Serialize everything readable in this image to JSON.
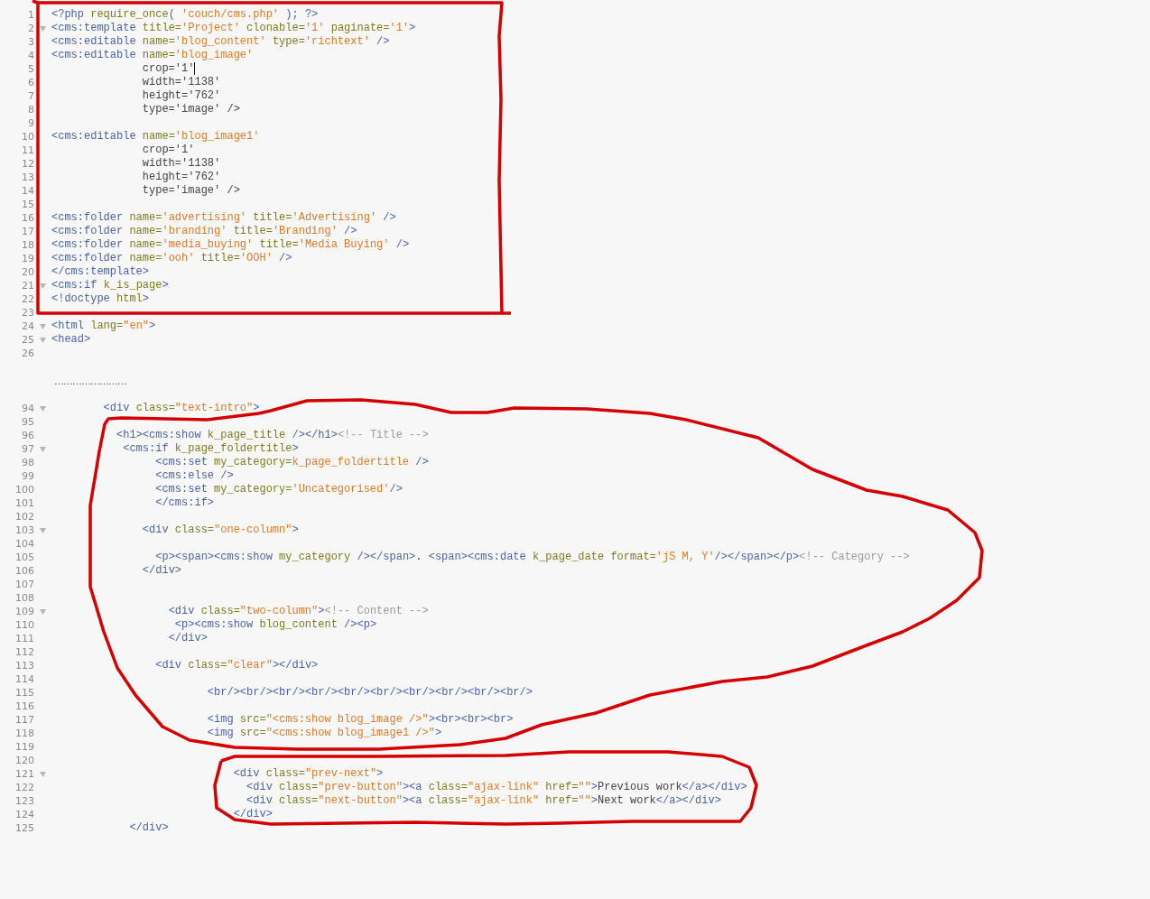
{
  "editor": {
    "lines": [
      {
        "kind": "code",
        "number": "1",
        "fold": false,
        "text": "<?php require_once( 'couch/cms.php' ); ?>"
      },
      {
        "kind": "code",
        "number": "2",
        "fold": true,
        "text": "<cms:template title='Project' clonable='1' paginate='1'>"
      },
      {
        "kind": "code",
        "number": "3",
        "fold": false,
        "text": "<cms:editable name='blog_content' type='richtext' />"
      },
      {
        "kind": "code",
        "number": "4",
        "fold": false,
        "text": "<cms:editable name='blog_image'"
      },
      {
        "kind": "code",
        "number": "5",
        "fold": false,
        "text": "              crop='1'",
        "cursor": true
      },
      {
        "kind": "code",
        "number": "6",
        "fold": false,
        "text": "              width='1138'"
      },
      {
        "kind": "code",
        "number": "7",
        "fold": false,
        "text": "              height='762'"
      },
      {
        "kind": "code",
        "number": "8",
        "fold": false,
        "text": "              type='image' />"
      },
      {
        "kind": "code",
        "number": "9",
        "fold": false
      },
      {
        "kind": "code",
        "number": "10",
        "fold": false,
        "text": "<cms:editable name='blog_image1'"
      },
      {
        "kind": "code",
        "number": "11",
        "fold": false,
        "text": "              crop='1'"
      },
      {
        "kind": "code",
        "number": "12",
        "fold": false,
        "text": "              width='1138'"
      },
      {
        "kind": "code",
        "number": "13",
        "fold": false,
        "text": "              height='762'"
      },
      {
        "kind": "code",
        "number": "14",
        "fold": false,
        "text": "              type='image' />"
      },
      {
        "kind": "code",
        "number": "15",
        "fold": false
      },
      {
        "kind": "code",
        "number": "16",
        "fold": false,
        "text": "<cms:folder name='advertising' title='Advertising' />"
      },
      {
        "kind": "code",
        "number": "17",
        "fold": false,
        "text": "<cms:folder name='branding' title='Branding' />"
      },
      {
        "kind": "code",
        "number": "18",
        "fold": false,
        "text": "<cms:folder name='media_buying' title='Media Buying' />"
      },
      {
        "kind": "code",
        "number": "19",
        "fold": false,
        "text": "<cms:folder name='ooh' title='OOH' />"
      },
      {
        "kind": "code",
        "number": "20",
        "fold": false,
        "text": "</cms:template>"
      },
      {
        "kind": "code",
        "number": "21",
        "fold": true,
        "text": "<cms:if k_is_page>"
      },
      {
        "kind": "code",
        "number": "22",
        "fold": false,
        "text": "<!doctype html>"
      },
      {
        "kind": "code",
        "number": "23",
        "fold": false
      },
      {
        "kind": "code",
        "number": "24",
        "fold": true,
        "text": "<html lang=\"en\">"
      },
      {
        "kind": "code",
        "number": "25",
        "fold": true,
        "text": "<head>"
      },
      {
        "kind": "code",
        "number": "26",
        "fold": false
      },
      {
        "kind": "gap",
        "text": "……………………"
      },
      {
        "kind": "code",
        "number": "94",
        "fold": true,
        "text": "        <div class=\"text-intro\">"
      },
      {
        "kind": "code",
        "number": "95",
        "fold": false
      },
      {
        "kind": "code",
        "number": "96",
        "fold": false,
        "text": "          <h1><cms:show k_page_title /></h1><!-- Title -->"
      },
      {
        "kind": "code",
        "number": "97",
        "fold": true,
        "text": "           <cms:if k_page_foldertitle>"
      },
      {
        "kind": "code",
        "number": "98",
        "fold": false,
        "text": "                <cms:set my_category=k_page_foldertitle />"
      },
      {
        "kind": "code",
        "number": "99",
        "fold": false,
        "text": "                <cms:else />"
      },
      {
        "kind": "code",
        "number": "100",
        "fold": false,
        "text": "                <cms:set my_category='Uncategorised'/>"
      },
      {
        "kind": "code",
        "number": "101",
        "fold": false,
        "text": "                </cms:if>"
      },
      {
        "kind": "code",
        "number": "102",
        "fold": false
      },
      {
        "kind": "code",
        "number": "103",
        "fold": true,
        "text": "              <div class=\"one-column\">"
      },
      {
        "kind": "code",
        "number": "104",
        "fold": false
      },
      {
        "kind": "code",
        "number": "105",
        "fold": false,
        "text": "                <p><span><cms:show my_category /></span>. <span><cms:date k_page_date format='jS M, Y'/></span></p><!-- Category -->"
      },
      {
        "kind": "code",
        "number": "106",
        "fold": false,
        "text": "              </div>"
      },
      {
        "kind": "code",
        "number": "107",
        "fold": false
      },
      {
        "kind": "code",
        "number": "108",
        "fold": false
      },
      {
        "kind": "code",
        "number": "109",
        "fold": true,
        "text": "                  <div class=\"two-column\"><!-- Content -->"
      },
      {
        "kind": "code",
        "number": "110",
        "fold": false,
        "text": "                   <p><cms:show blog_content /><p>"
      },
      {
        "kind": "code",
        "number": "111",
        "fold": false,
        "text": "                  </div>"
      },
      {
        "kind": "code",
        "number": "112",
        "fold": false
      },
      {
        "kind": "code",
        "number": "113",
        "fold": false,
        "text": "                <div class=\"clear\"></div>"
      },
      {
        "kind": "code",
        "number": "114",
        "fold": false
      },
      {
        "kind": "code",
        "number": "115",
        "fold": false,
        "text": "                        <br/><br/><br/><br/><br/><br/><br/><br/><br/><br/>"
      },
      {
        "kind": "code",
        "number": "116",
        "fold": false
      },
      {
        "kind": "code",
        "number": "117",
        "fold": false,
        "text": "                        <img src=\"<cms:show blog_image />\"><br><br><br>"
      },
      {
        "kind": "code",
        "number": "118",
        "fold": false,
        "text": "                        <img src=\"<cms:show blog_image1 />\">"
      },
      {
        "kind": "code",
        "number": "119",
        "fold": false
      },
      {
        "kind": "code",
        "number": "120",
        "fold": false
      },
      {
        "kind": "code",
        "number": "121",
        "fold": true,
        "text": "                            <div class=\"prev-next\">"
      },
      {
        "kind": "code",
        "number": "122",
        "fold": false,
        "text": "                              <div class=\"prev-button\"><a class=\"ajax-link\" href=\"\">Previous work</a></div>"
      },
      {
        "kind": "code",
        "number": "123",
        "fold": false,
        "text": "                              <div class=\"next-button\"><a class=\"ajax-link\" href=\"\">Next work</a></div>"
      },
      {
        "kind": "code",
        "number": "124",
        "fold": false,
        "text": "                            </div>"
      },
      {
        "kind": "code",
        "number": "125",
        "fold": false,
        "text": "            </div>"
      }
    ]
  },
  "annotations": [
    {
      "kind": "rectangle"
    },
    {
      "kind": "loop"
    },
    {
      "kind": "loop"
    }
  ]
}
